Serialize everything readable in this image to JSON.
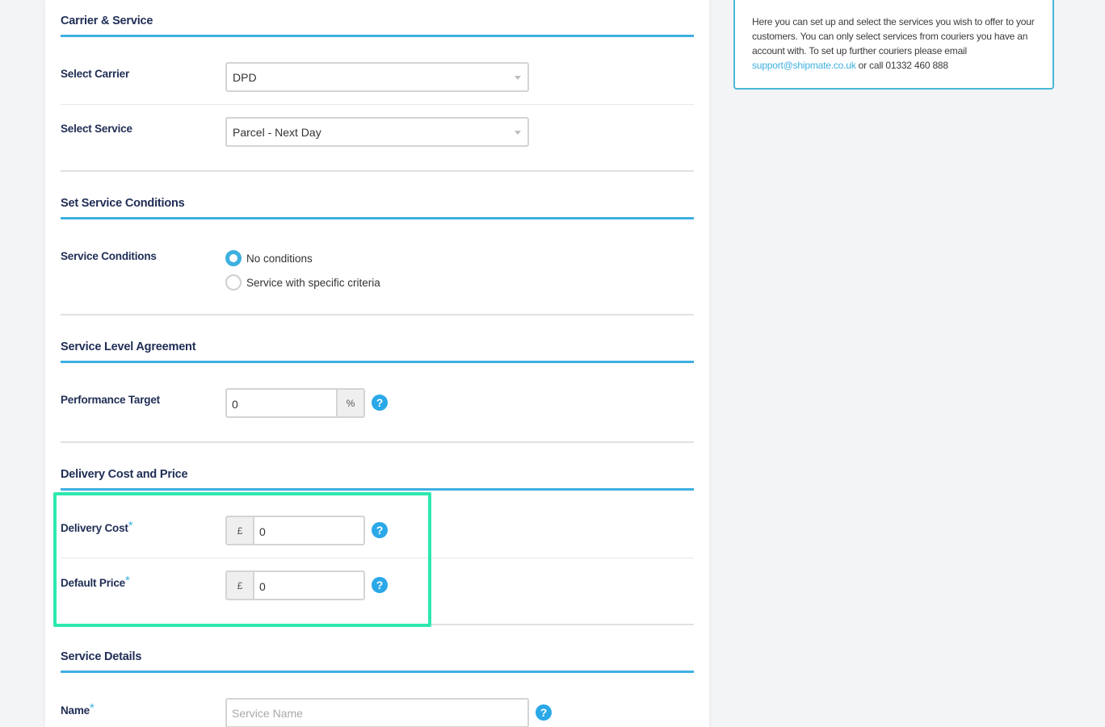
{
  "sections": {
    "carrier_service": {
      "title": "Carrier & Service",
      "carrier_label": "Select Carrier",
      "carrier_value": "DPD",
      "service_label": "Select Service",
      "service_value": "Parcel - Next Day"
    },
    "conditions": {
      "title": "Set Service Conditions",
      "label": "Service Conditions",
      "options": [
        {
          "label": "No conditions",
          "checked": true
        },
        {
          "label": "Service with specific criteria",
          "checked": false
        }
      ]
    },
    "sla": {
      "title": "Service Level Agreement",
      "label": "Performance Target",
      "value": "0",
      "suffix": "%"
    },
    "cost_price": {
      "title": "Delivery Cost and Price",
      "delivery_cost_label": "Delivery Cost",
      "delivery_cost_currency": "£",
      "delivery_cost_value": "0",
      "default_price_label": "Default Price",
      "default_price_currency": "£",
      "default_price_value": "0",
      "required_mark": "*"
    },
    "details": {
      "title": "Service Details",
      "name_label": "Name",
      "name_placeholder": "Service Name",
      "required_mark": "*"
    }
  },
  "help_icon_glyph": "?",
  "info_box": {
    "text_before": "Here you can set up and select the services you wish to offer to your customers. You can only select services from couriers you have an account with. To set up further couriers please email ",
    "email": "support@shipmate.co.uk",
    "text_after": " or call 01332 460 888"
  },
  "colors": {
    "accent": "#3eb0e0",
    "heading": "#1f2d55",
    "highlight": "#2ee8b0",
    "help_icon": "#2aa8e8"
  }
}
